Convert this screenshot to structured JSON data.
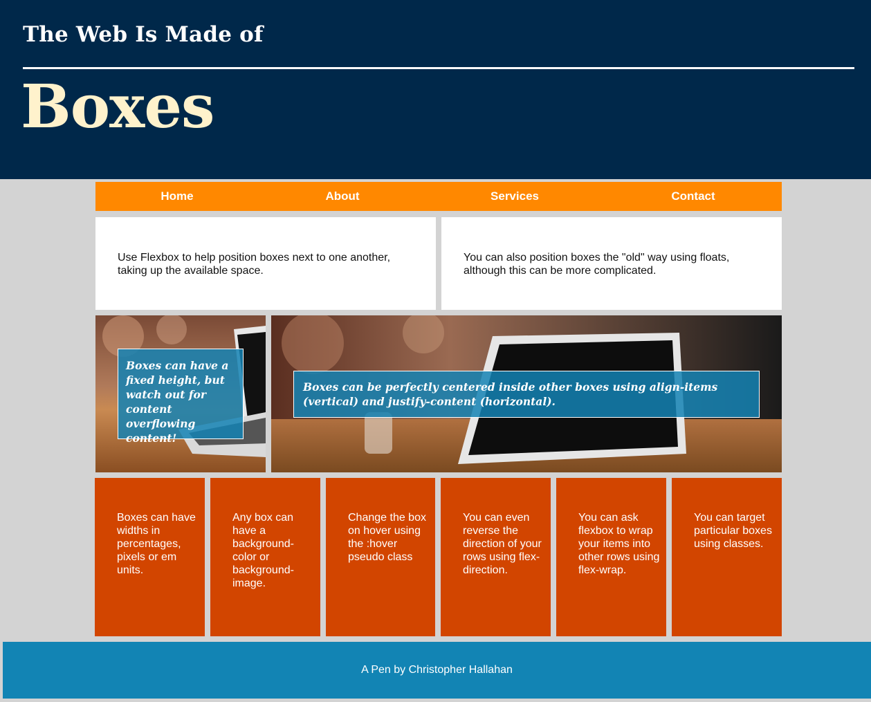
{
  "header": {
    "subtitle": "The Web Is Made of",
    "title": "Boxes"
  },
  "nav": {
    "items": [
      "Home",
      "About",
      "Services",
      "Contact"
    ]
  },
  "intro": {
    "left": "Use Flexbox to help position boxes next to one another, taking up the available space.",
    "right": "You can also position boxes the \"old\" way using floats, although this can be more complicated."
  },
  "feature": {
    "left_caption": "Boxes can have a fixed height, but watch out for content overflowing content!",
    "right_caption": "Boxes can be perfectly centered inside other boxes using align-items (vertical) and justify-content (horizontal)."
  },
  "tiles": [
    "Boxes can have widths in percentages, pixels or em units.",
    "Any box can have a background-color or background-image.",
    "Change the box on hover using the :hover pseudo class",
    "You can even reverse the direction of your rows using flex-direction.",
    "You can ask flexbox to wrap your items into other rows using flex-wrap.",
    "You can target particular boxes using classes."
  ],
  "footer": {
    "text": "A Pen by Christopher Hallahan"
  },
  "colors": {
    "header_bg": "#00284a",
    "nav_bg": "#ff8800",
    "tile_bg": "#d24500",
    "footer_bg": "#1284b4",
    "title_color": "#fff2cc"
  }
}
